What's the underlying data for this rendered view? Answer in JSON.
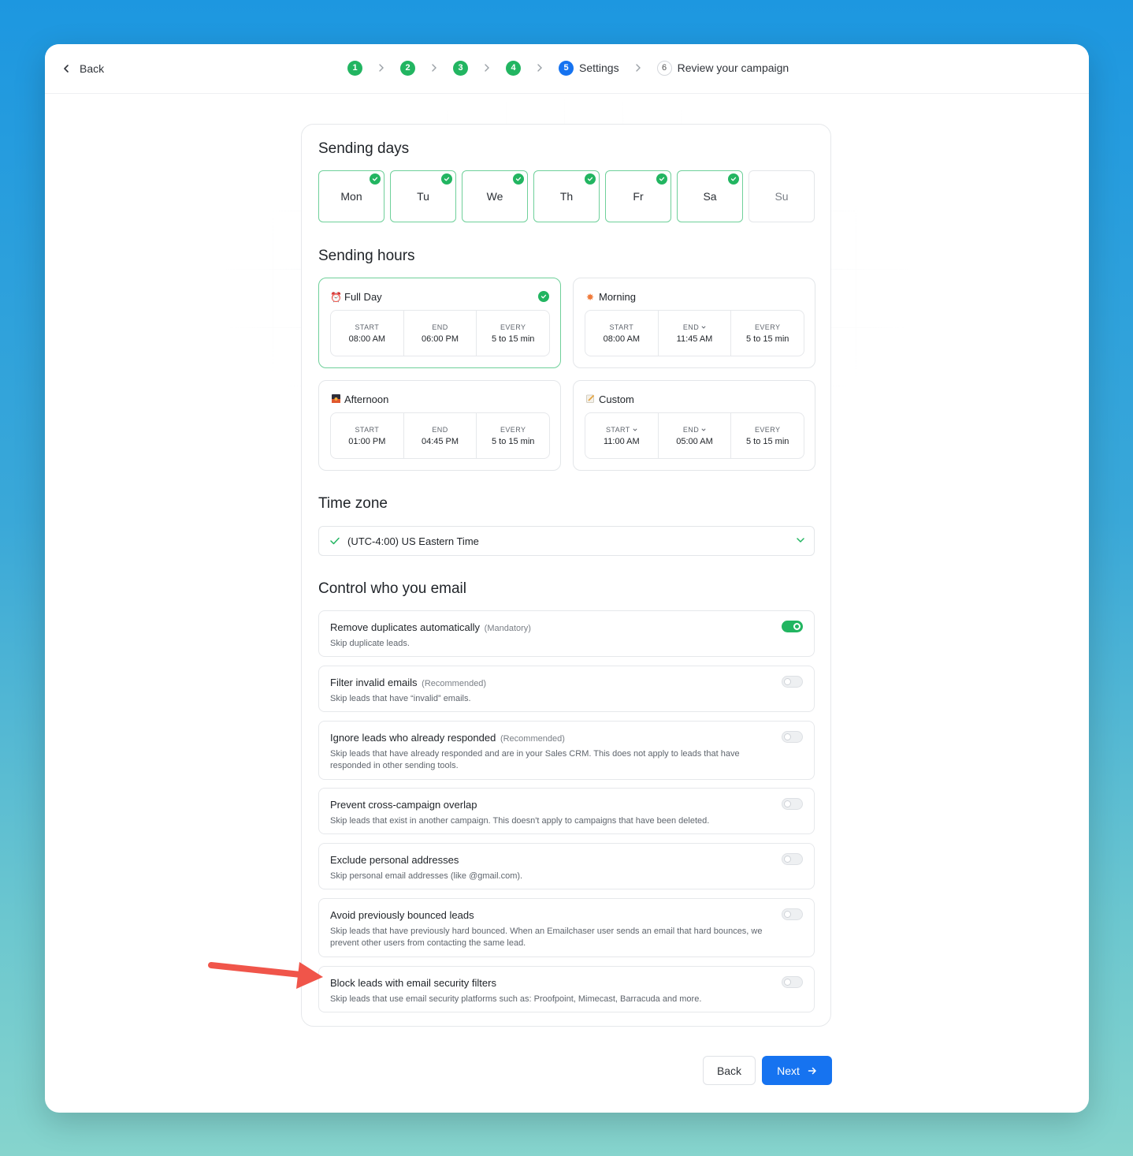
{
  "colors": {
    "accent": "#1673f0",
    "success": "#22b561",
    "annotation_arrow": "#f0554a"
  },
  "header": {
    "back_label": "Back",
    "steps": [
      {
        "number": "1",
        "label": "",
        "state": "done"
      },
      {
        "number": "2",
        "label": "",
        "state": "done"
      },
      {
        "number": "3",
        "label": "",
        "state": "done"
      },
      {
        "number": "4",
        "label": "",
        "state": "done"
      },
      {
        "number": "5",
        "label": "Settings",
        "state": "active"
      },
      {
        "number": "6",
        "label": "Review your campaign",
        "state": "todo"
      }
    ]
  },
  "sending_days": {
    "title": "Sending days",
    "days": [
      {
        "label": "Mon",
        "selected": true
      },
      {
        "label": "Tu",
        "selected": true
      },
      {
        "label": "We",
        "selected": true
      },
      {
        "label": "Th",
        "selected": true
      },
      {
        "label": "Fr",
        "selected": true
      },
      {
        "label": "Sa",
        "selected": true
      },
      {
        "label": "Su",
        "selected": false
      }
    ]
  },
  "sending_hours": {
    "title": "Sending hours",
    "options": [
      {
        "icon": "alarm-clock-icon",
        "label": "Full Day",
        "selected": true,
        "start_label": "START",
        "start": "08:00 AM",
        "end_label": "END",
        "end": "06:00 PM",
        "every_label": "EVERY",
        "every": "5 to 15 min"
      },
      {
        "icon": "sunrise-icon",
        "label": "Morning",
        "selected": false,
        "start_label": "START",
        "start": "08:00 AM",
        "end_label": "END",
        "end": "11:45 AM",
        "every_label": "EVERY",
        "every": "5 to 15 min"
      },
      {
        "icon": "sunset-icon",
        "label": "Afternoon",
        "selected": false,
        "start_label": "START",
        "start": "01:00 PM",
        "end_label": "END",
        "end": "04:45 PM",
        "every_label": "EVERY",
        "every": "5 to 15 min"
      },
      {
        "icon": "memo-icon",
        "label": "Custom",
        "selected": false,
        "start_label": "START",
        "start": "11:00 AM",
        "end_label": "END",
        "end": "05:00 AM",
        "every_label": "EVERY",
        "every": "5 to 15 min"
      }
    ]
  },
  "time_zone": {
    "title": "Time zone",
    "value": "(UTC-4:00) US Eastern Time"
  },
  "control": {
    "title": "Control who you email",
    "options": [
      {
        "title": "Remove duplicates automatically",
        "tag": "(Mandatory)",
        "desc": "Skip duplicate leads.",
        "enabled": true
      },
      {
        "title": "Filter invalid emails",
        "tag": "(Recommended)",
        "desc": "Skip leads that have “invalid” emails.",
        "enabled": false
      },
      {
        "title": "Ignore leads who already responded",
        "tag": "(Recommended)",
        "desc": "Skip leads that have already responded and are in your Sales CRM. This does not apply to leads that have responded in other sending tools.",
        "enabled": false
      },
      {
        "title": "Prevent cross-campaign overlap",
        "tag": "",
        "desc": "Skip leads that exist in another campaign. This doesn't apply to campaigns that have been deleted.",
        "enabled": false
      },
      {
        "title": "Exclude personal addresses",
        "tag": "",
        "desc": "Skip personal email addresses (like @gmail.com).",
        "enabled": false
      },
      {
        "title": "Avoid previously bounced leads",
        "tag": "",
        "desc": "Skip leads that have previously hard bounced. When an Emailchaser user sends an email that hard bounces, we prevent other users from contacting the same lead.",
        "enabled": false
      },
      {
        "title": "Block leads with email security filters",
        "tag": "",
        "desc": "Skip leads that use email security platforms such as: Proofpoint, Mimecast, Barracuda and more.",
        "enabled": false
      }
    ]
  },
  "footer": {
    "back_label": "Back",
    "next_label": "Next"
  }
}
